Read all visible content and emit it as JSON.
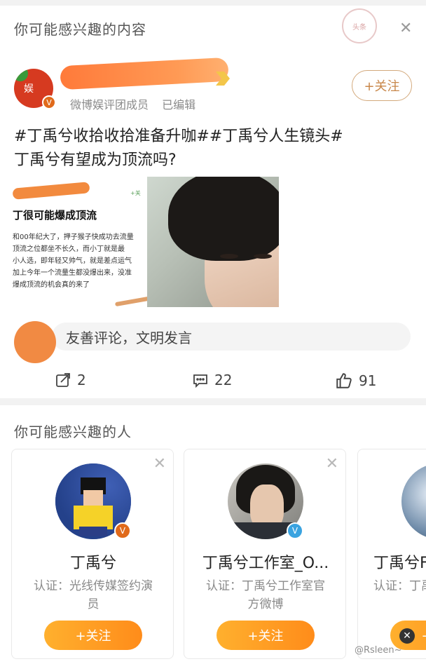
{
  "feed": {
    "section_title": "你可能感兴趣的内容",
    "stamp_text": "头条",
    "author": {
      "avatar_text": "娱",
      "member_role": "微博娱评团成员",
      "edited": "已编辑",
      "follow_label": "+关注"
    },
    "post": {
      "tags": "#丁禹兮收拾收拾准备升咖##丁禹兮人生镜头#",
      "question": "丁禹兮有望成为顶流吗?",
      "image_left": {
        "tag": "+关",
        "headline": "丁很可能爆成顶流",
        "paragraph": [
          "和00年纪大了，押子猴子快成功去流量",
          "顶流之位都坐不长久，而小丁就是最",
          "小人选，即年轻又帅气，就是差点运气",
          "加上今年一个流量生都没爆出来，没准",
          "爆成顶流的机会真的来了"
        ]
      }
    },
    "comment_placeholder": "友善评论，文明发言",
    "stats": {
      "reposts": "2",
      "comments": "22",
      "likes": "91"
    }
  },
  "people": {
    "section_title": "你可能感兴趣的人",
    "cards": [
      {
        "name": "丁禹兮",
        "desc": "认证：光线传媒签约演员",
        "follow": "+关注",
        "badge": "V",
        "badge_color": "#e06a1b"
      },
      {
        "name": "丁禹兮工作室_O...",
        "desc": "认证：丁禹兮工作室官方微博",
        "follow": "+关注",
        "badge": "V",
        "badge_color": "#3aa3e0"
      },
      {
        "name": "丁禹兮F",
        "desc": "认证：丁禹兮后",
        "follow": "+关注"
      }
    ]
  },
  "watermark": "@Rsleen~"
}
